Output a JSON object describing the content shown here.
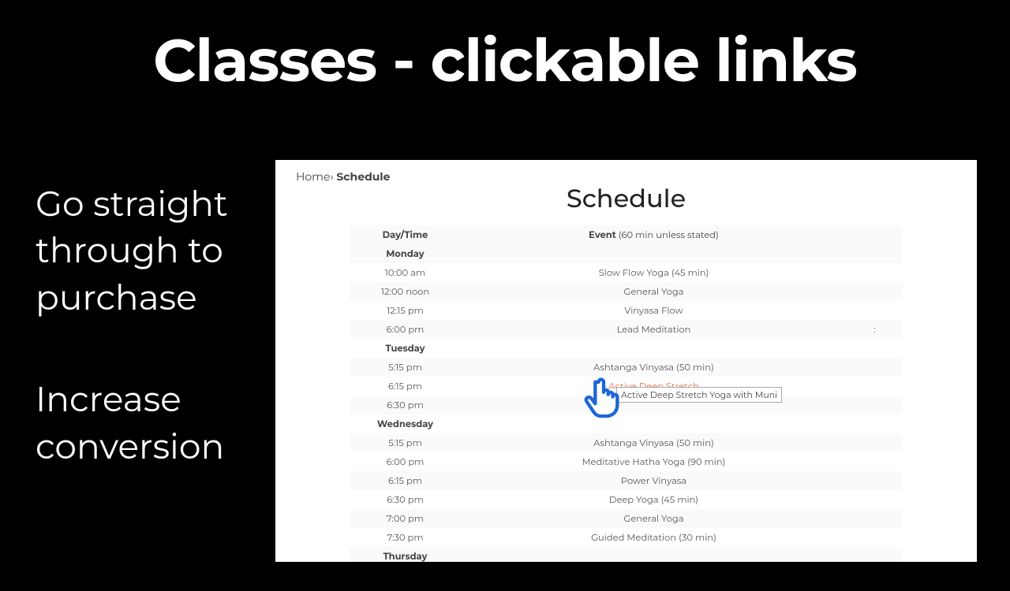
{
  "title": "Classes - clickable links",
  "copy": {
    "p1a": "Go straight",
    "p1b": "through to",
    "p1c": "purchase",
    "p2a": "Increase",
    "p2b": "conversion"
  },
  "tooltip": "Active Deep Stretch Yoga with Muni",
  "page": {
    "crumb_home": "Home",
    "crumb_sep": "›",
    "crumb_current": "Schedule",
    "heading": "Schedule",
    "col1": "Day/Time",
    "col2_label": "Event",
    "col2_note": " (60 min unless stated)",
    "rows": [
      {
        "time": "Monday",
        "event": "",
        "day": true
      },
      {
        "time": "10:00 am",
        "event": "Slow Flow Yoga (45 min)"
      },
      {
        "time": "12:00 noon",
        "event": "General Yoga"
      },
      {
        "time": "12:15 pm",
        "event": "Vinyasa Flow"
      },
      {
        "time": "6:00 pm",
        "event": "Lead Meditation",
        "extra": ":"
      },
      {
        "time": "Tuesday",
        "event": "",
        "day": true
      },
      {
        "time": "5:15 pm",
        "event": "Ashtanga Vinyasa (50 min)"
      },
      {
        "time": "6:15 pm",
        "event": "Active Deep Stretch",
        "link": true
      },
      {
        "time": "6:30 pm",
        "event": ""
      },
      {
        "time": "Wednesday",
        "event": "",
        "day": true
      },
      {
        "time": "5:15 pm",
        "event": "Ashtanga Vinyasa (50 min)"
      },
      {
        "time": "6:00 pm",
        "event": "Meditative Hatha Yoga (90 min)"
      },
      {
        "time": "6:15 pm",
        "event": "Power Vinyasa"
      },
      {
        "time": "6:30 pm",
        "event": "Deep Yoga (45 min)"
      },
      {
        "time": "7:00 pm",
        "event": "General Yoga"
      },
      {
        "time": "7:30 pm",
        "event": "Guided Meditation (30 min)"
      },
      {
        "time": "Thursday",
        "event": "",
        "day": true
      }
    ]
  }
}
